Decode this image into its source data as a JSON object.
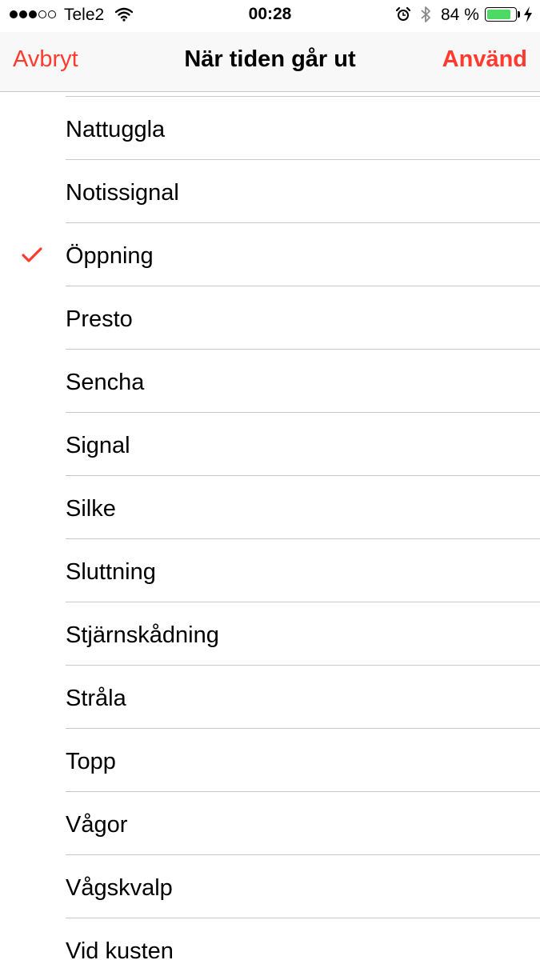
{
  "status_bar": {
    "signal_filled": 3,
    "signal_total": 5,
    "carrier": "Tele2",
    "time": "00:28",
    "battery_percent": "84 %",
    "battery_level": 0.84,
    "icons": [
      "wifi-icon",
      "alarm-icon",
      "bluetooth-icon",
      "battery-icon",
      "charging-bolt-icon"
    ]
  },
  "nav": {
    "cancel_label": "Avbryt",
    "title": "När tiden går ut",
    "use_label": "Använd"
  },
  "colors": {
    "accent": "#ff3b30",
    "battery_fill": "#4cd964",
    "separator": "#c8c7cc"
  },
  "sounds": {
    "selected": "Öppning",
    "items": [
      "Nattuggla",
      "Notissignal",
      "Öppning",
      "Presto",
      "Sencha",
      "Signal",
      "Silke",
      "Sluttning",
      "Stjärnskådning",
      "Stråla",
      "Topp",
      "Vågor",
      "Vågskvalp",
      "Vid kusten"
    ]
  }
}
